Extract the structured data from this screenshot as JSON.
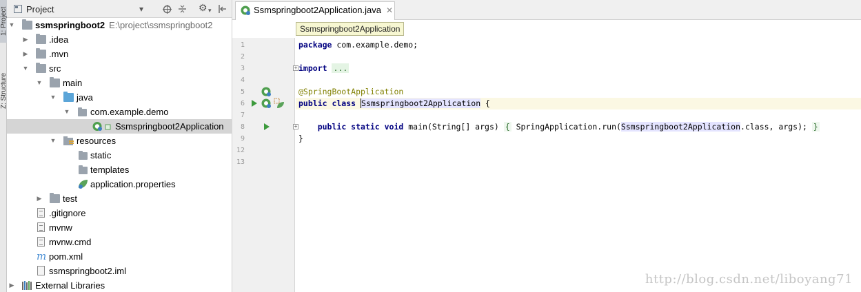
{
  "toolwindows": {
    "project_tab": "1: Project",
    "structure_tab": "Z: Structure"
  },
  "project_panel": {
    "title": "Project",
    "tree": [
      {
        "label": "ssmspringboot2",
        "hint": "E:\\project\\ssmspringboot2",
        "icon": "module-folder-icon",
        "expanded": true,
        "depth": 0
      },
      {
        "label": ".idea",
        "icon": "folder-icon",
        "expanded": false,
        "depth": 1
      },
      {
        "label": ".mvn",
        "icon": "folder-icon",
        "expanded": false,
        "depth": 1
      },
      {
        "label": "src",
        "icon": "folder-icon",
        "expanded": true,
        "depth": 1
      },
      {
        "label": "main",
        "icon": "folder-icon",
        "expanded": true,
        "depth": 2
      },
      {
        "label": "java",
        "icon": "source-folder-icon",
        "expanded": true,
        "depth": 3
      },
      {
        "label": "com.example.demo",
        "icon": "package-icon",
        "expanded": true,
        "depth": 4
      },
      {
        "label": "Ssmspringboot2Application",
        "icon": "spring-boot-class-icon",
        "depth": 5,
        "selected": true
      },
      {
        "label": "resources",
        "icon": "resources-folder-icon",
        "expanded": true,
        "depth": 3
      },
      {
        "label": "static",
        "icon": "folder-icon",
        "depth": 4
      },
      {
        "label": "templates",
        "icon": "folder-icon",
        "depth": 4
      },
      {
        "label": "application.properties",
        "icon": "spring-properties-icon",
        "depth": 4
      },
      {
        "label": "test",
        "icon": "folder-icon",
        "expanded": false,
        "depth": 2
      },
      {
        "label": ".gitignore",
        "icon": "text-file-icon",
        "depth": 1
      },
      {
        "label": "mvnw",
        "icon": "text-file-icon",
        "depth": 1
      },
      {
        "label": "mvnw.cmd",
        "icon": "text-file-icon",
        "depth": 1
      },
      {
        "label": "pom.xml",
        "icon": "maven-icon",
        "depth": 1
      },
      {
        "label": "ssmspringboot2.iml",
        "icon": "iml-file-icon",
        "depth": 1
      },
      {
        "label": "External Libraries",
        "icon": "libraries-icon",
        "expanded": false,
        "depth": 0
      }
    ]
  },
  "editor": {
    "tab_label": "Ssmspringboot2Application.java",
    "breadcrumb": "Ssmspringboot2Application",
    "line_numbers": [
      "1",
      "2",
      "3",
      "4",
      "5",
      "6",
      "7",
      "8",
      "9",
      "12",
      "13"
    ],
    "code": {
      "l1_kw": "package",
      "l1_rest": " com.example.demo;",
      "l3_kw": "import",
      "l3_fold": "...",
      "l6_ann": "@SpringBootApplication",
      "l7_kw": "public class",
      "l7_class": "Ssmspringboot2Application",
      "l7_rest": " {",
      "l9_kw": "public static void",
      "l9_a": " main(String[] args) ",
      "l9_brace_open": "{",
      "l9_b": " SpringApplication.run(",
      "l9_class": "Ssmspringboot2Application",
      "l9_c": ".class, args); ",
      "l9_brace_close": "}",
      "l12": "}"
    }
  },
  "watermark": "http://blog.csdn.net/liboyang71"
}
